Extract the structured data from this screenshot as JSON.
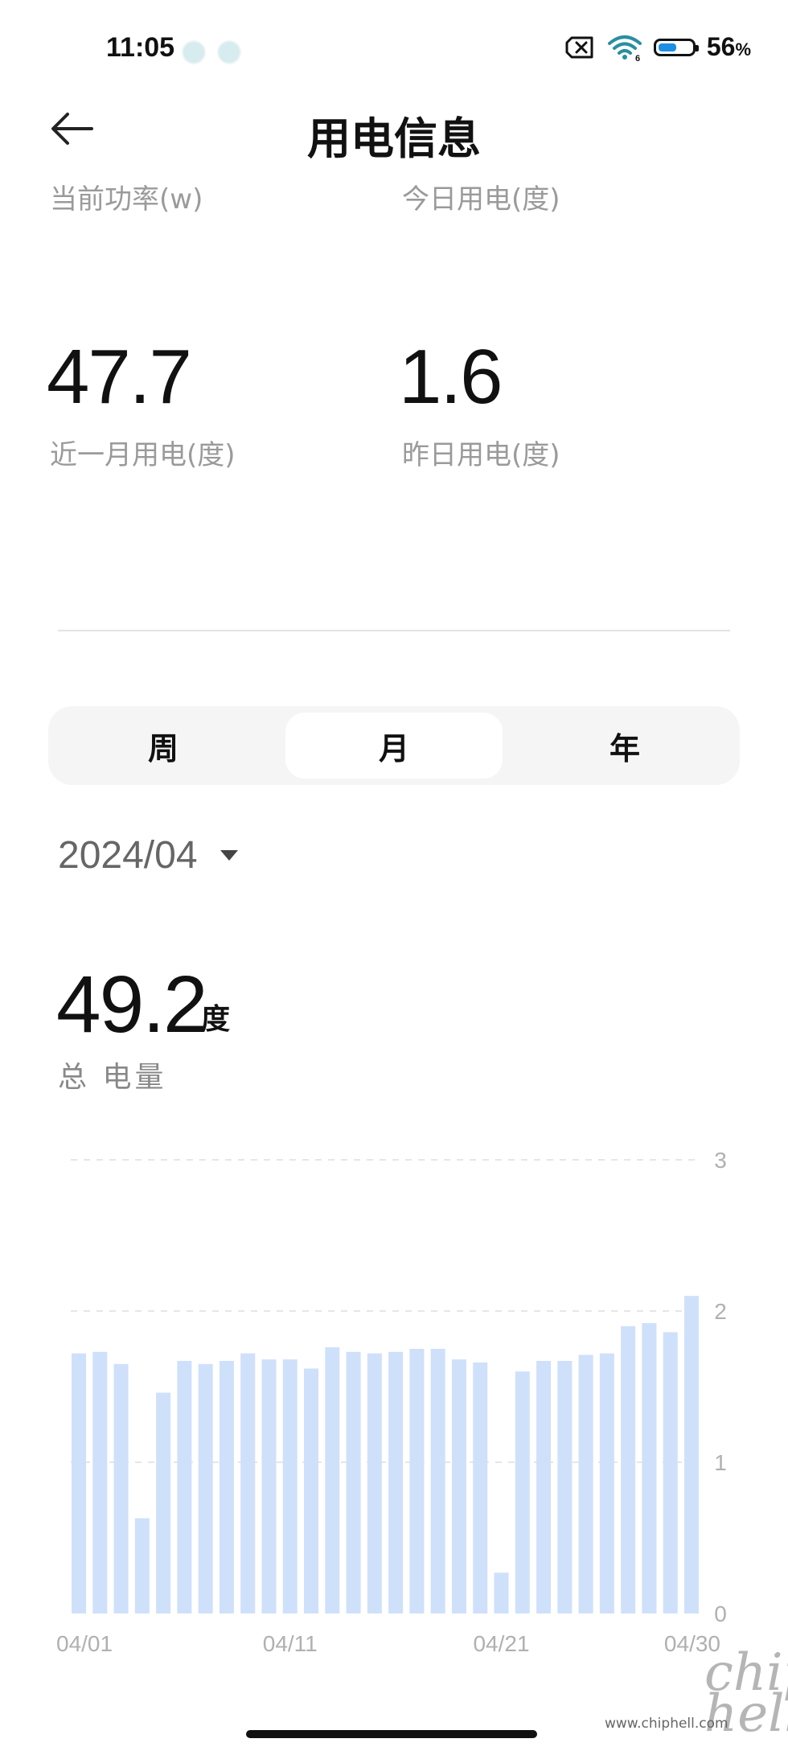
{
  "status_bar": {
    "time": "11:05",
    "battery_percent": 56,
    "battery_text": "56",
    "battery_unit": "%",
    "icons": [
      "shield-app-icon",
      "wechat-app-icon",
      "no-sim-icon",
      "wifi-icon",
      "battery-icon"
    ]
  },
  "header": {
    "title": "用电信息",
    "back_icon": "arrow-left-icon"
  },
  "stats": {
    "current_power_label": "当前功率(w)",
    "today_label": "今日用电(度)",
    "month_value": "47.7",
    "month_label": "近一月用电(度)",
    "yesterday_value": "1.6",
    "yesterday_label": "昨日用电(度)"
  },
  "segment": {
    "tabs": [
      "周",
      "月",
      "年"
    ],
    "selected": "月"
  },
  "date_picker": {
    "value": "2024/04"
  },
  "total": {
    "value": "49.2",
    "unit": "度",
    "label": "总 电量"
  },
  "colors": {
    "bar": "#cfe0fb",
    "grid": "#e6e6e6",
    "tick_text": "#b0b0b0"
  },
  "chart_data": {
    "type": "bar",
    "categories": [
      "04/01",
      "04/02",
      "04/03",
      "04/04",
      "04/05",
      "04/06",
      "04/07",
      "04/08",
      "04/09",
      "04/10",
      "04/11",
      "04/12",
      "04/13",
      "04/14",
      "04/15",
      "04/16",
      "04/17",
      "04/18",
      "04/19",
      "04/20",
      "04/21",
      "04/22",
      "04/23",
      "04/24",
      "04/25",
      "04/26",
      "04/27",
      "04/28",
      "04/29",
      "04/30"
    ],
    "values": [
      1.72,
      1.73,
      1.65,
      0.63,
      1.46,
      1.67,
      1.65,
      1.67,
      1.72,
      1.68,
      1.68,
      1.62,
      1.76,
      1.73,
      1.72,
      1.73,
      1.75,
      1.75,
      1.68,
      1.66,
      0.27,
      1.6,
      1.67,
      1.67,
      1.71,
      1.72,
      1.9,
      1.92,
      1.86,
      2.1
    ],
    "x_tick_labels": [
      "04/01",
      "04/11",
      "04/21",
      "04/30"
    ],
    "y_ticks": [
      "0",
      "1",
      "2",
      "3"
    ],
    "ylim": [
      0,
      3
    ],
    "grid": true,
    "y_axis_side": "right"
  },
  "watermark": {
    "logo": "chip hell",
    "url": "www.chiphell.com"
  }
}
